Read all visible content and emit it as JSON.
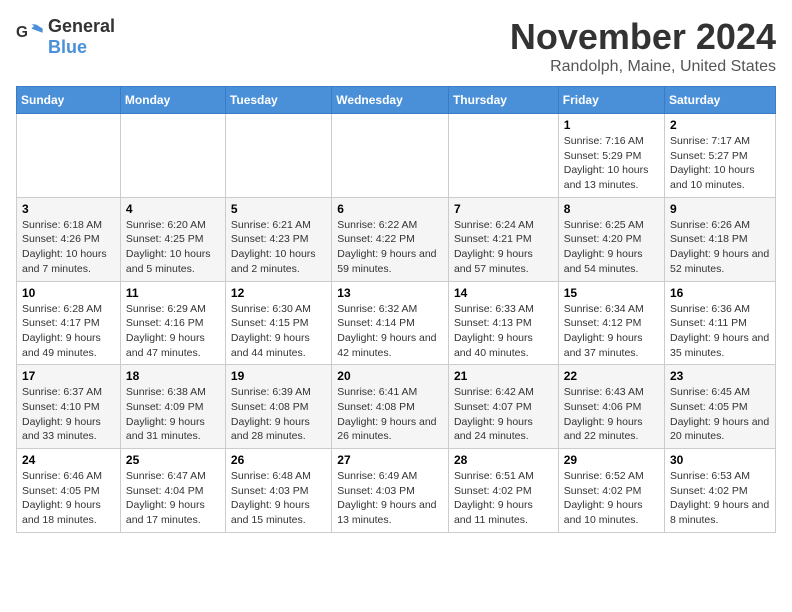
{
  "logo": {
    "text_general": "General",
    "text_blue": "Blue"
  },
  "title": "November 2024",
  "location": "Randolph, Maine, United States",
  "weekdays": [
    "Sunday",
    "Monday",
    "Tuesday",
    "Wednesday",
    "Thursday",
    "Friday",
    "Saturday"
  ],
  "weeks": [
    [
      {
        "day": "",
        "info": ""
      },
      {
        "day": "",
        "info": ""
      },
      {
        "day": "",
        "info": ""
      },
      {
        "day": "",
        "info": ""
      },
      {
        "day": "",
        "info": ""
      },
      {
        "day": "1",
        "info": "Sunrise: 7:16 AM\nSunset: 5:29 PM\nDaylight: 10 hours and 13 minutes."
      },
      {
        "day": "2",
        "info": "Sunrise: 7:17 AM\nSunset: 5:27 PM\nDaylight: 10 hours and 10 minutes."
      }
    ],
    [
      {
        "day": "3",
        "info": "Sunrise: 6:18 AM\nSunset: 4:26 PM\nDaylight: 10 hours and 7 minutes."
      },
      {
        "day": "4",
        "info": "Sunrise: 6:20 AM\nSunset: 4:25 PM\nDaylight: 10 hours and 5 minutes."
      },
      {
        "day": "5",
        "info": "Sunrise: 6:21 AM\nSunset: 4:23 PM\nDaylight: 10 hours and 2 minutes."
      },
      {
        "day": "6",
        "info": "Sunrise: 6:22 AM\nSunset: 4:22 PM\nDaylight: 9 hours and 59 minutes."
      },
      {
        "day": "7",
        "info": "Sunrise: 6:24 AM\nSunset: 4:21 PM\nDaylight: 9 hours and 57 minutes."
      },
      {
        "day": "8",
        "info": "Sunrise: 6:25 AM\nSunset: 4:20 PM\nDaylight: 9 hours and 54 minutes."
      },
      {
        "day": "9",
        "info": "Sunrise: 6:26 AM\nSunset: 4:18 PM\nDaylight: 9 hours and 52 minutes."
      }
    ],
    [
      {
        "day": "10",
        "info": "Sunrise: 6:28 AM\nSunset: 4:17 PM\nDaylight: 9 hours and 49 minutes."
      },
      {
        "day": "11",
        "info": "Sunrise: 6:29 AM\nSunset: 4:16 PM\nDaylight: 9 hours and 47 minutes."
      },
      {
        "day": "12",
        "info": "Sunrise: 6:30 AM\nSunset: 4:15 PM\nDaylight: 9 hours and 44 minutes."
      },
      {
        "day": "13",
        "info": "Sunrise: 6:32 AM\nSunset: 4:14 PM\nDaylight: 9 hours and 42 minutes."
      },
      {
        "day": "14",
        "info": "Sunrise: 6:33 AM\nSunset: 4:13 PM\nDaylight: 9 hours and 40 minutes."
      },
      {
        "day": "15",
        "info": "Sunrise: 6:34 AM\nSunset: 4:12 PM\nDaylight: 9 hours and 37 minutes."
      },
      {
        "day": "16",
        "info": "Sunrise: 6:36 AM\nSunset: 4:11 PM\nDaylight: 9 hours and 35 minutes."
      }
    ],
    [
      {
        "day": "17",
        "info": "Sunrise: 6:37 AM\nSunset: 4:10 PM\nDaylight: 9 hours and 33 minutes."
      },
      {
        "day": "18",
        "info": "Sunrise: 6:38 AM\nSunset: 4:09 PM\nDaylight: 9 hours and 31 minutes."
      },
      {
        "day": "19",
        "info": "Sunrise: 6:39 AM\nSunset: 4:08 PM\nDaylight: 9 hours and 28 minutes."
      },
      {
        "day": "20",
        "info": "Sunrise: 6:41 AM\nSunset: 4:08 PM\nDaylight: 9 hours and 26 minutes."
      },
      {
        "day": "21",
        "info": "Sunrise: 6:42 AM\nSunset: 4:07 PM\nDaylight: 9 hours and 24 minutes."
      },
      {
        "day": "22",
        "info": "Sunrise: 6:43 AM\nSunset: 4:06 PM\nDaylight: 9 hours and 22 minutes."
      },
      {
        "day": "23",
        "info": "Sunrise: 6:45 AM\nSunset: 4:05 PM\nDaylight: 9 hours and 20 minutes."
      }
    ],
    [
      {
        "day": "24",
        "info": "Sunrise: 6:46 AM\nSunset: 4:05 PM\nDaylight: 9 hours and 18 minutes."
      },
      {
        "day": "25",
        "info": "Sunrise: 6:47 AM\nSunset: 4:04 PM\nDaylight: 9 hours and 17 minutes."
      },
      {
        "day": "26",
        "info": "Sunrise: 6:48 AM\nSunset: 4:03 PM\nDaylight: 9 hours and 15 minutes."
      },
      {
        "day": "27",
        "info": "Sunrise: 6:49 AM\nSunset: 4:03 PM\nDaylight: 9 hours and 13 minutes."
      },
      {
        "day": "28",
        "info": "Sunrise: 6:51 AM\nSunset: 4:02 PM\nDaylight: 9 hours and 11 minutes."
      },
      {
        "day": "29",
        "info": "Sunrise: 6:52 AM\nSunset: 4:02 PM\nDaylight: 9 hours and 10 minutes."
      },
      {
        "day": "30",
        "info": "Sunrise: 6:53 AM\nSunset: 4:02 PM\nDaylight: 9 hours and 8 minutes."
      }
    ]
  ]
}
